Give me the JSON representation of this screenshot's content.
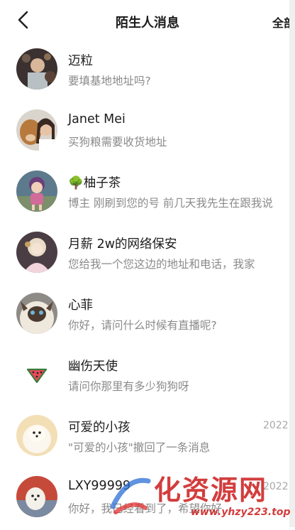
{
  "header": {
    "back_icon": "chevron-left-icon",
    "title": "陌生人消息",
    "action_label": "全部"
  },
  "messages": [
    {
      "name": "迈粒",
      "preview": "要填基地地址吗?",
      "time": ""
    },
    {
      "name": "Janet Mei",
      "preview": "买狗粮需要收货地址",
      "time": ""
    },
    {
      "name": "🌳柚子茶",
      "preview": "博主 刚刷到您的号 前几天我先生在跟我说",
      "time": ""
    },
    {
      "name": "月薪 2w的网络保安",
      "preview": "您给我一个您这边的地址和电话，我家",
      "time": ""
    },
    {
      "name": "心菲",
      "preview": "你好，请问什么时候有直播呢?",
      "time": ""
    },
    {
      "name": "幽伤天使",
      "preview": "请问你那里有多少狗狗呀",
      "time": ""
    },
    {
      "name": "可爱的小孩",
      "preview": "\"可爱的小孩\"撤回了一条消息",
      "time": "2022"
    },
    {
      "name": "LXY99999",
      "preview": "你好，我已经看到了，希望你好",
      "time": "2022"
    }
  ],
  "watermark": {
    "text": "化资源网",
    "url": "www.yhzy223.top"
  },
  "colors": {
    "background": "#ffffff",
    "name_text": "#1c1c1c",
    "preview_text": "#8a8a8a",
    "time_text": "#a8a8a8",
    "watermark": "#cc1c1c"
  }
}
